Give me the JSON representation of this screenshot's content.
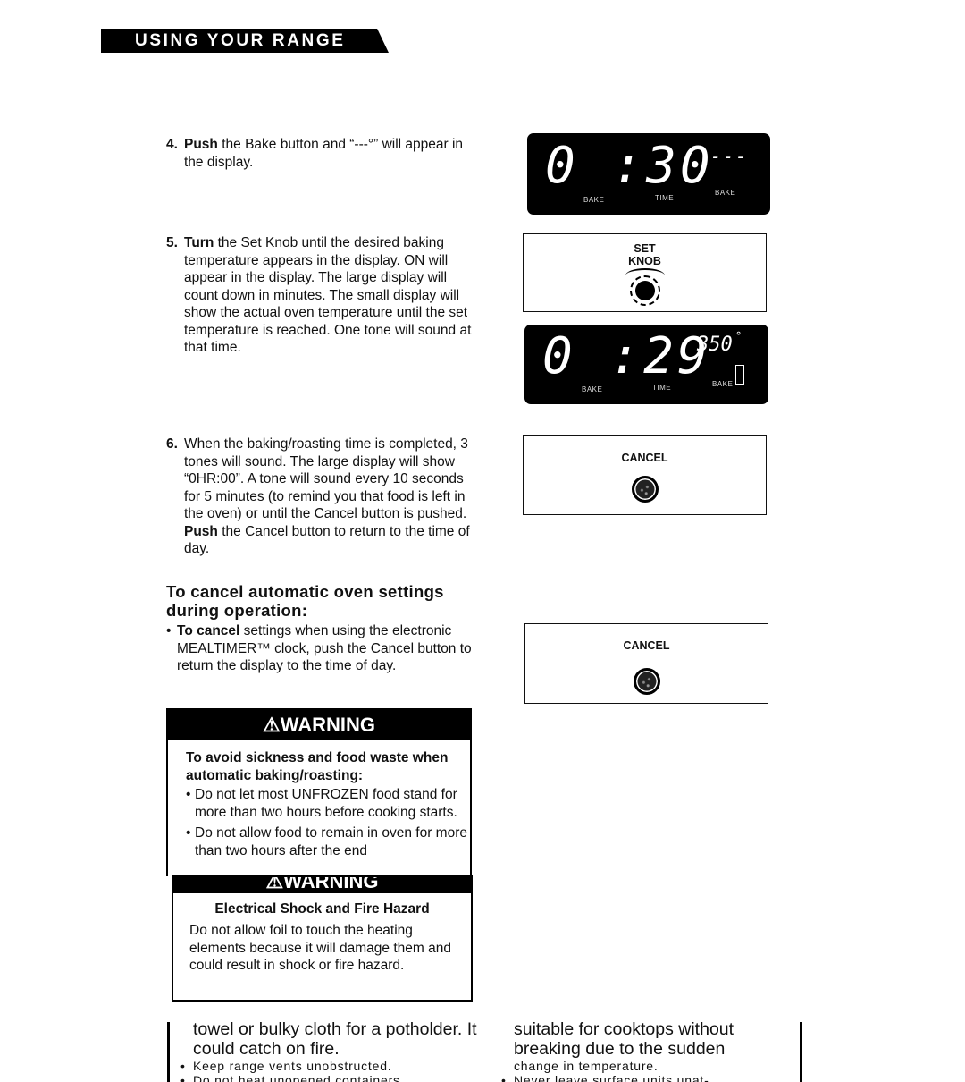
{
  "header": {
    "title": "USING YOUR RANGE"
  },
  "steps": [
    {
      "number": "4.",
      "lead": "Push",
      "text": " the Bake button and “---°” will appear in the display."
    },
    {
      "number": "5.",
      "lead": "Turn",
      "text": " the Set Knob until the desired baking temperature appears in the display. ON will appear in the display. The large display will count down in minutes. The small display will show the actual oven temperature until the set temperature is reached. One tone will sound at that time."
    },
    {
      "number": "6.",
      "text_before": "When the baking/roasting time is completed, 3 tones will sound. The large display will show “0HR:00”. A tone will sound every 10 seconds for 5 minutes (to remind you that food is left in the oven) or until the Cancel button is pushed. ",
      "lead": "Push",
      "text_after": " the Cancel button to return to the time of day."
    }
  ],
  "cancel_section": {
    "heading": "To cancel automatic oven settings during operation:",
    "bullet_lead": "To cancel",
    "bullet_text": " settings when using the electronic MEALTIMER™ clock, push the Cancel button to return the display to the time of day."
  },
  "displays": [
    {
      "big": "0 :30",
      "small": "---",
      "degree": "°",
      "labels": [
        "BAKE",
        "TIME",
        "BAKE"
      ]
    },
    {
      "big": "0 :29",
      "small": "350",
      "degree": "°",
      "labels": [
        "BAKE",
        "TIME",
        "BAKE"
      ]
    }
  ],
  "panels": {
    "set_knob": "SET\nKNOB",
    "set_knob_line1": "SET",
    "set_knob_line2": "KNOB",
    "cancel1": "CANCEL",
    "cancel2": "CANCEL"
  },
  "warning1": {
    "title": "WARNING",
    "subtitle": "To avoid sickness and food waste when automatic baking/roasting:",
    "items": [
      "Do not let most UNFROZEN food stand for more than two hours before cooking starts.",
      "Do not allow food to remain in oven for more than two hours after the end"
    ]
  },
  "warning2": {
    "title": "WARNING",
    "subtitle": "Electrical Shock and Fire Hazard",
    "body": "Do not allow foil to touch the heating elements because it will damage them and could result in shock or fire hazard."
  },
  "bottom_left": {
    "large": "towel or bulky cloth for a potholder. It could catch on fire.",
    "bullets": [
      "Keep range vents unobstructed.",
      "Do not heat unopened containers"
    ]
  },
  "bottom_right": {
    "large": "suitable for cooktops without breaking due to the sudden",
    "small": "change in temperature.",
    "bullets": [
      "Never leave surface units unat-"
    ]
  }
}
